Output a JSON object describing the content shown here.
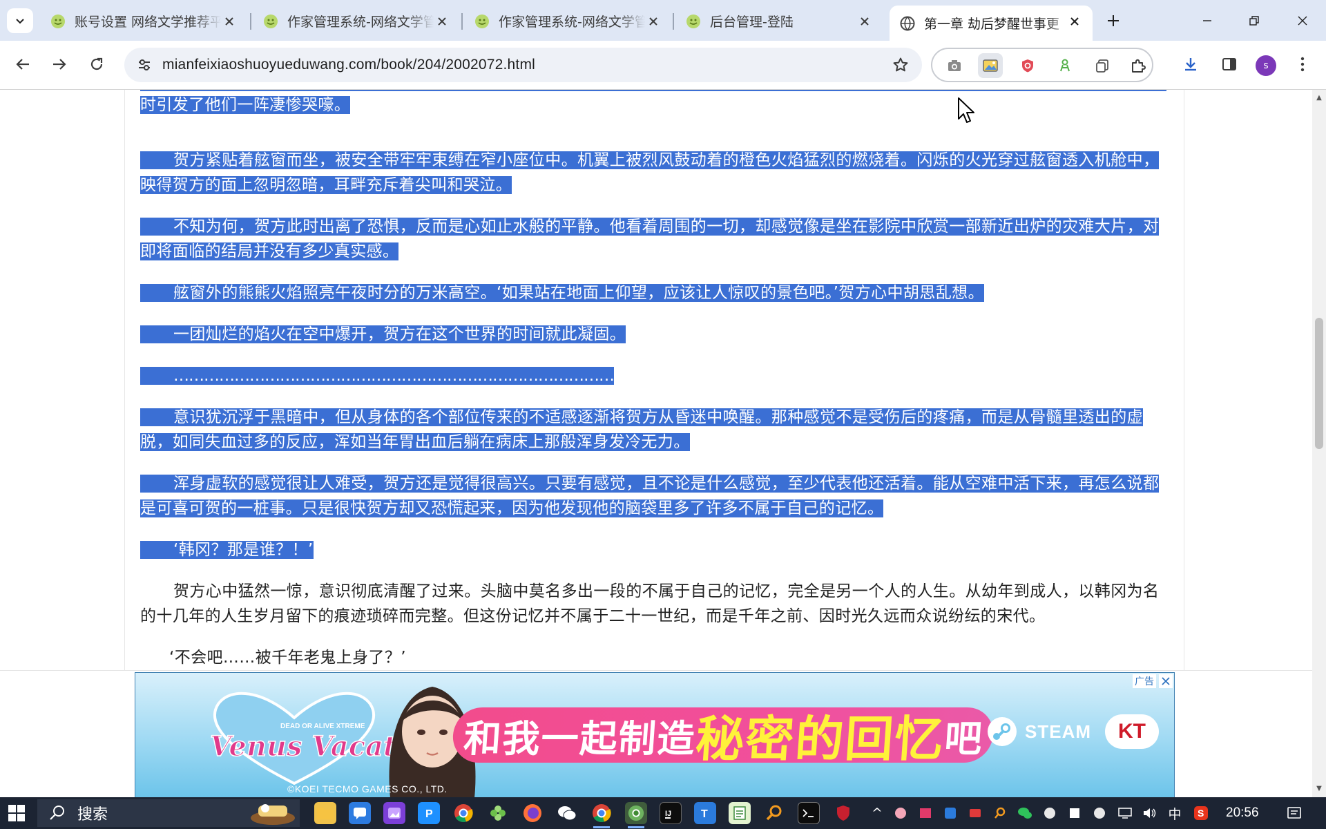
{
  "browser": {
    "tabs": [
      {
        "title": "账号设置 网络文学推荐平台",
        "favicon": "yellow-green-smile-favicon",
        "active": false
      },
      {
        "title": "作家管理系统-网络文学管理",
        "favicon": "yellow-green-smile-favicon",
        "active": false
      },
      {
        "title": "作家管理系统-网络文学管理",
        "favicon": "yellow-green-smile-favicon",
        "active": false
      },
      {
        "title": "后台管理-登陆",
        "favicon": "yellow-green-smile-favicon",
        "active": false
      },
      {
        "title": "第一章   劫后梦醒世事更",
        "favicon": "globe-favicon",
        "active": true
      }
    ],
    "url": "mianfeixiaoshuoyueduwang.com/book/204/2002072.html",
    "profile_initial": "s",
    "accent_color": "#3b6fd4"
  },
  "article": {
    "paragraphs": [
      {
        "text": "时引发了他们一阵凄惨哭嚎。",
        "selected": true,
        "indent": false
      },
      {
        "text": "贺方紧贴着舷窗而坐，被安全带牢牢束缚在窄小座位中。机翼上被烈风鼓动着的橙色火焰猛烈的燃烧着。闪烁的火光穿过舷窗透入机舱中，映得贺方的面上忽明忽暗，耳畔充斥着尖叫和哭泣。",
        "selected": true,
        "indent": true
      },
      {
        "text": "不知为何，贺方此时出离了恐惧，反而是心如止水般的平静。他看着周围的一切，却感觉像是坐在影院中欣赏一部新近出炉的灾难大片，对即将面临的结局并没有多少真实感。",
        "selected": true,
        "indent": true
      },
      {
        "text": "舷窗外的熊熊火焰照亮午夜时分的万米高空。‘如果站在地面上仰望，应该让人惊叹的景色吧。’贺方心中胡思乱想。",
        "selected": true,
        "indent": true
      },
      {
        "text": "一团灿烂的焰火在空中爆开，贺方在这个世界的时间就此凝固。",
        "selected": true,
        "indent": true
      },
      {
        "text": "……………………………………………………………………………",
        "selected": true,
        "indent": true
      },
      {
        "text": "意识犹沉浮于黑暗中，但从身体的各个部位传来的不适感逐渐将贺方从昏迷中唤醒。那种感觉不是受伤后的疼痛，而是从骨髓里透出的虚脱，如同失血过多的反应，浑如当年胃出血后躺在病床上那般浑身发冷无力。",
        "selected": true,
        "indent": true
      },
      {
        "text": "浑身虚软的感觉很让人难受，贺方还是觉得很高兴。只要有感觉，且不论是什么感觉，至少代表他还活着。能从空难中活下来，再怎么说都是可喜可贺的一桩事。只是很快贺方却又恐慌起来，因为他发现他的脑袋里多了许多不属于自己的记忆。",
        "selected": true,
        "indent": true
      },
      {
        "text": "‘韩冈？那是谁？！’",
        "selected": true,
        "indent": true
      },
      {
        "text": "贺方心中猛然一惊，意识彻底清醒了过来。头脑中莫名多出一段的不属于自己的记忆，完全是另一个人的人生。从幼年到成人，以韩冈为名的十几年的人生岁月留下的痕迹琐碎而完整。但这份记忆并不属于二十一世纪，而是千年之前、因时光久远而众说纷纭的宋代。",
        "selected": false,
        "indent": true
      },
      {
        "text": "‘不会吧……被千年老鬼上身了？’",
        "selected": false,
        "indent": true
      }
    ]
  },
  "ad": {
    "label": "广告",
    "game_logo": "Venus Vacation",
    "game_logo_sub": "DEAD OR ALIVE XTREME",
    "slogan_part1": "和我一起制造",
    "slogan_part2": "秘密的回忆",
    "slogan_part3": "吧",
    "steam": "STEAM",
    "kt": "KT",
    "copyright": "©KOEI TECMO GAMES CO., LTD."
  },
  "taskbar": {
    "search_label": "搜索",
    "ime": "中",
    "time": "20:56"
  }
}
